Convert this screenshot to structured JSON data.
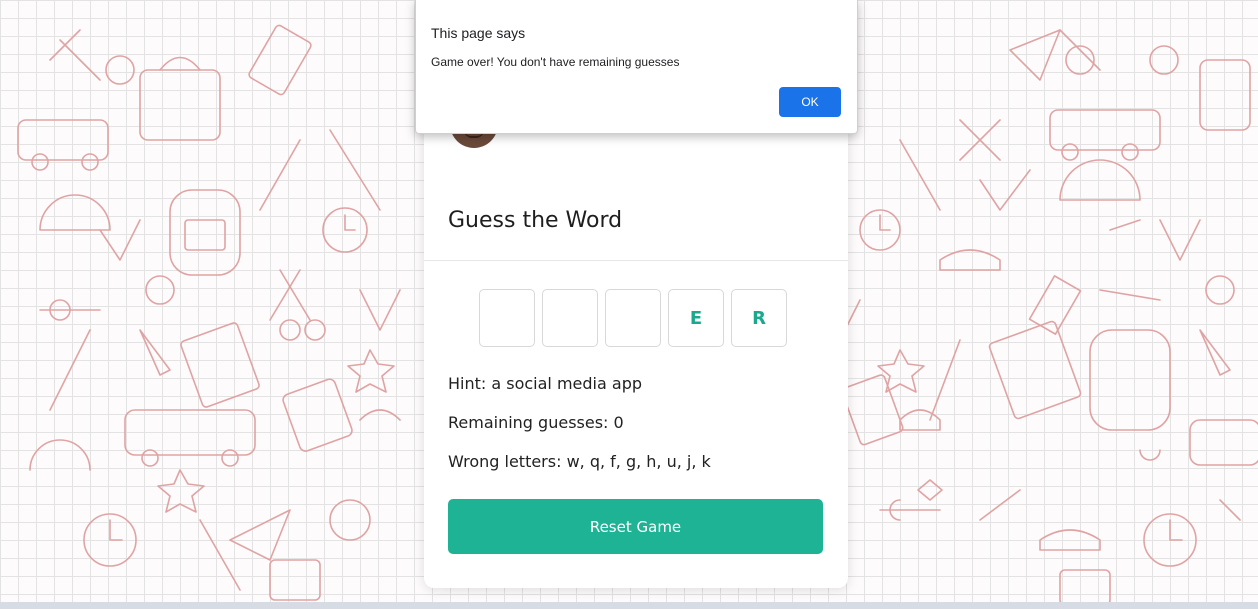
{
  "dialog": {
    "title": "This page says",
    "message": "Game over! You don't have remaining guesses",
    "ok_label": "OK"
  },
  "game": {
    "title": "Guess the Word",
    "tiles": [
      "",
      "",
      "",
      "E",
      "R"
    ],
    "hint": "Hint: a social media app",
    "remaining": "Remaining guesses: 0",
    "wrong": "Wrong letters: w, q, f, g, h, u, j, k",
    "reset_label": "Reset Game"
  },
  "colors": {
    "accent": "#1db394",
    "letter": "#1aa88f",
    "dialog_button": "#1a73e8",
    "doodle": "#e0a3a3"
  }
}
